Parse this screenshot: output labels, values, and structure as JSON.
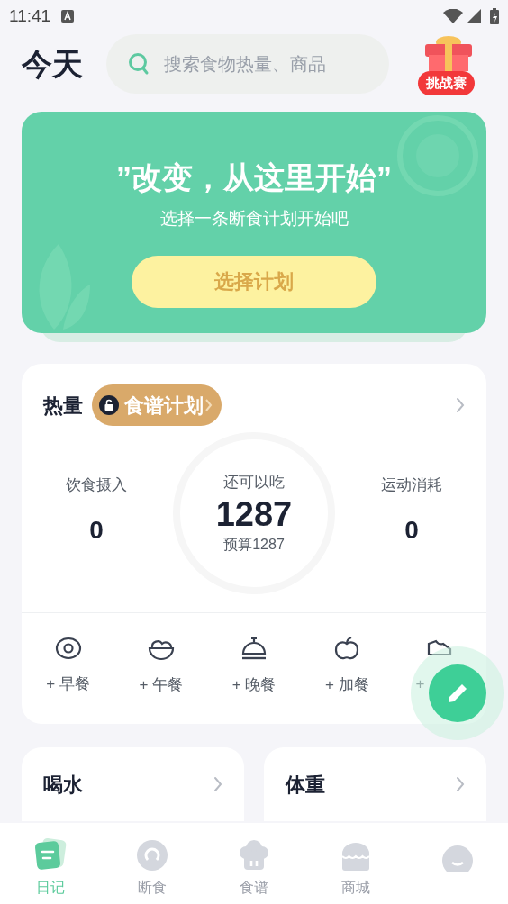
{
  "status_bar": {
    "time": "11:41"
  },
  "header": {
    "title": "今天",
    "search": {
      "placeholder": "搜索食物热量、商品"
    },
    "challenge_badge": "挑战赛"
  },
  "banner": {
    "headline": "”改变，从这里开始”",
    "subtitle": "选择一条断食计划开始吧",
    "button": "选择计划"
  },
  "calories": {
    "title": "热量",
    "plan_tag": "食谱计划",
    "plan_locked": true,
    "stats": [
      {
        "label": "饮食摄入",
        "value": "0"
      },
      {
        "label": "运动消耗",
        "value": "0"
      }
    ],
    "remaining": {
      "label": "还可以吃",
      "value": "1287",
      "budget": "预算1287"
    },
    "meals": [
      {
        "kind": "breakfast",
        "label": "+ 早餐"
      },
      {
        "kind": "lunch",
        "label": "+ 午餐"
      },
      {
        "kind": "dinner",
        "label": "+ 晚餐"
      },
      {
        "kind": "snack",
        "label": "+ 加餐"
      },
      {
        "kind": "exercise",
        "label": "+"
      }
    ]
  },
  "cards": [
    {
      "title": "喝水"
    },
    {
      "title": "体重"
    }
  ],
  "tab_bar": [
    {
      "kind": "diary",
      "label": "日记",
      "selected": true
    },
    {
      "kind": "fasting",
      "label": "断食",
      "selected": false
    },
    {
      "kind": "recipes",
      "label": "食谱",
      "selected": false
    },
    {
      "kind": "shop",
      "label": "商城",
      "selected": false
    },
    {
      "kind": "profile",
      "selected": false
    }
  ]
}
